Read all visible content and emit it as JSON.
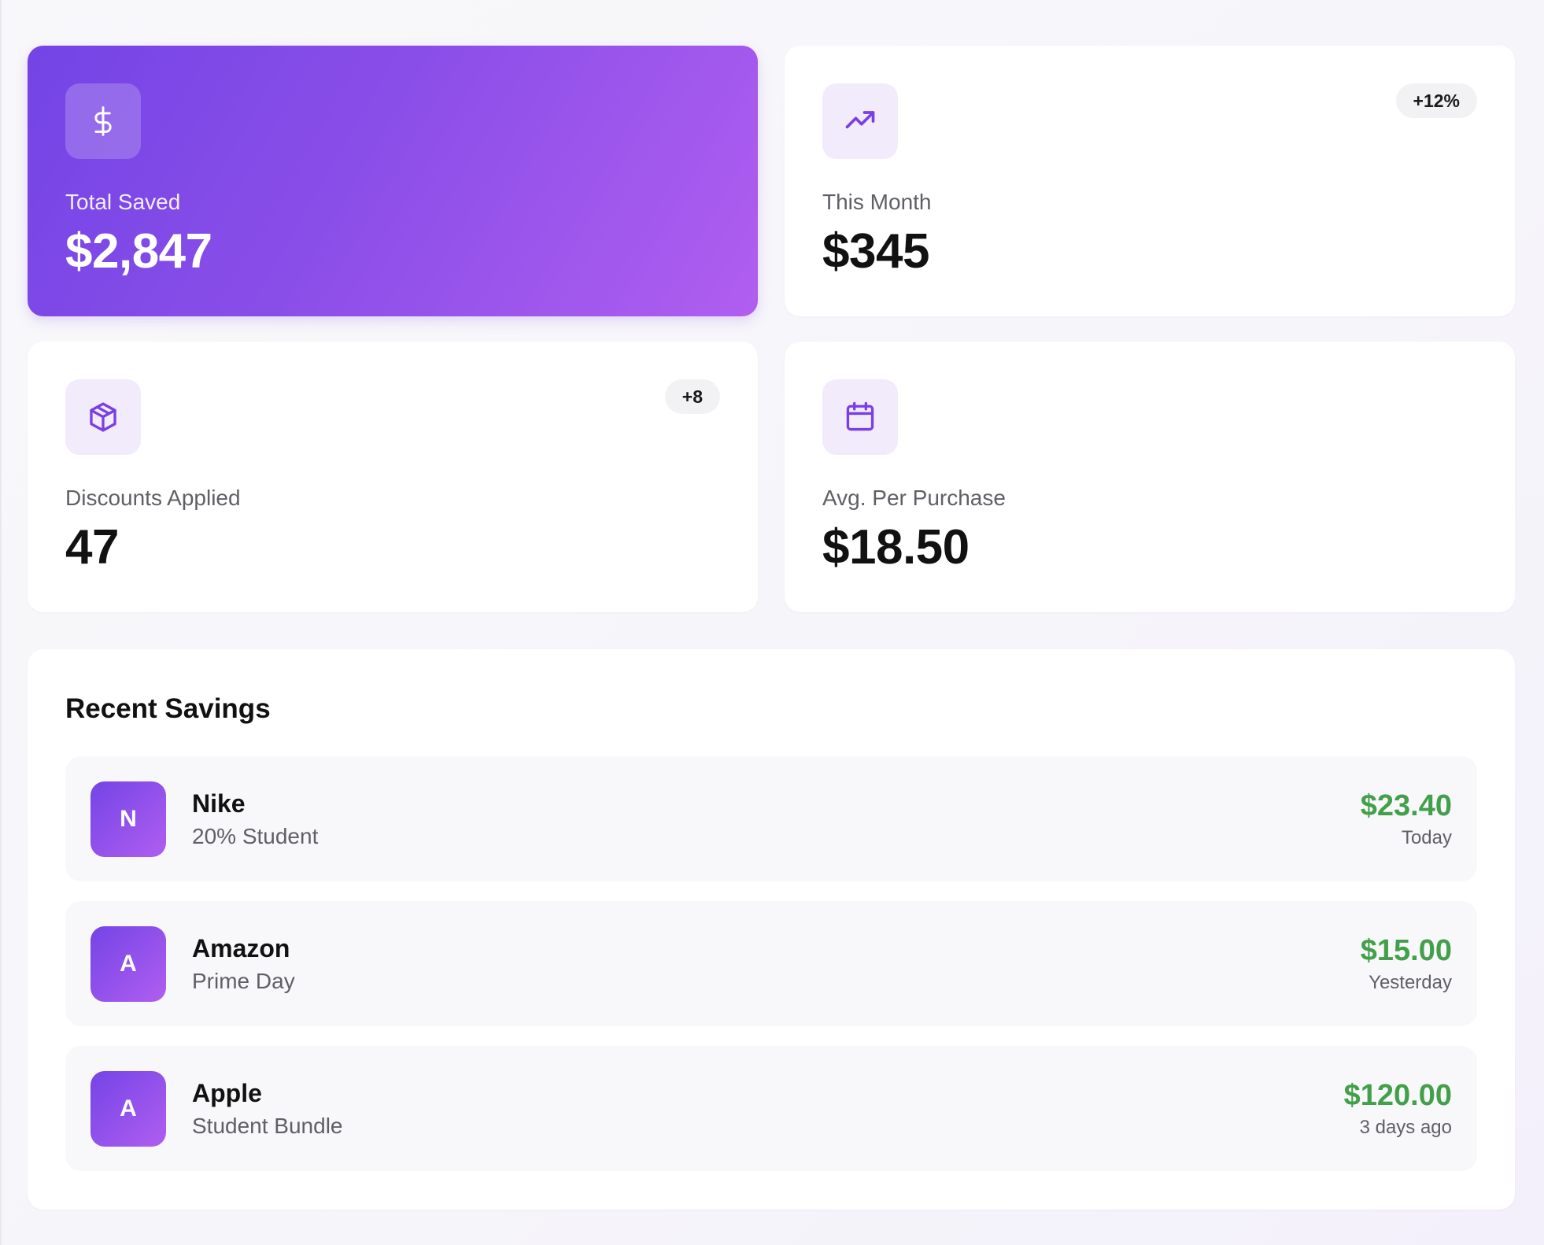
{
  "stats": {
    "total_saved": {
      "icon": "dollar-icon",
      "label": "Total Saved",
      "value": "$2,847"
    },
    "this_month": {
      "icon": "trending-up-icon",
      "label": "This Month",
      "value": "$345",
      "badge": "+12%"
    },
    "discounts_applied": {
      "icon": "package-icon",
      "label": "Discounts Applied",
      "value": "47",
      "badge": "+8"
    },
    "avg_per_purchase": {
      "icon": "calendar-icon",
      "label": "Avg. Per Purchase",
      "value": "$18.50"
    }
  },
  "recent": {
    "title": "Recent Savings",
    "items": [
      {
        "initial": "N",
        "name": "Nike",
        "description": "20% Student",
        "amount": "$23.40",
        "time": "Today"
      },
      {
        "initial": "A",
        "name": "Amazon",
        "description": "Prime Day",
        "amount": "$15.00",
        "time": "Yesterday"
      },
      {
        "initial": "A",
        "name": "Apple",
        "description": "Student Bundle",
        "amount": "$120.00",
        "time": "3 days ago"
      }
    ]
  },
  "colors": {
    "accent_purple": "#7a3fe4",
    "gradient_start": "#7444e6",
    "gradient_end": "#b05ef0",
    "savings_green": "#43a04a",
    "muted_text": "#5f5f66",
    "badge_background": "#f2f2f4",
    "icon_tile_background": "#f1ebfb"
  }
}
